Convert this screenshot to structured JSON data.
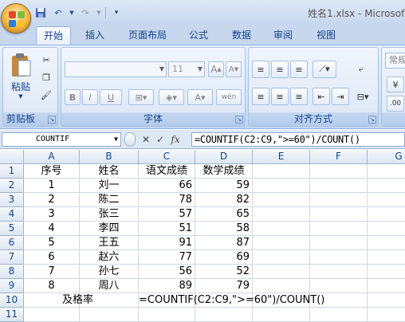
{
  "window": {
    "title": "姓名1.xlsx - Microsof"
  },
  "tabs": [
    "开始",
    "插入",
    "页面布局",
    "公式",
    "数据",
    "审阅",
    "视图"
  ],
  "ribbon": {
    "clipboard": {
      "label": "剪贴板",
      "paste": "粘贴"
    },
    "font": {
      "label": "字体",
      "font_size": "11",
      "bold": "B",
      "italic": "I",
      "underline": "U",
      "wen": "wén"
    },
    "alignment": {
      "label": "对齐方式"
    },
    "number": {
      "format": "常规"
    }
  },
  "formula_bar": {
    "name_box": "COUNTIF",
    "formula": "=COUNTIF(C2:C9,\">=60\")/COUNT()"
  },
  "columns": [
    "A",
    "B",
    "C",
    "D",
    "E",
    "F",
    "G"
  ],
  "rows": [
    {
      "n": "1",
      "a": "序号",
      "b": "姓名",
      "c": "语文成绩",
      "d": "数学成绩"
    },
    {
      "n": "2",
      "a": "1",
      "b": "刘一",
      "c": "66",
      "d": "59"
    },
    {
      "n": "3",
      "a": "2",
      "b": "陈二",
      "c": "78",
      "d": "82"
    },
    {
      "n": "4",
      "a": "3",
      "b": "张三",
      "c": "57",
      "d": "65"
    },
    {
      "n": "5",
      "a": "4",
      "b": "李四",
      "c": "51",
      "d": "58"
    },
    {
      "n": "6",
      "a": "5",
      "b": "王五",
      "c": "91",
      "d": "87"
    },
    {
      "n": "7",
      "a": "6",
      "b": "赵六",
      "c": "77",
      "d": "69"
    },
    {
      "n": "8",
      "a": "7",
      "b": "孙七",
      "c": "56",
      "d": "52"
    },
    {
      "n": "9",
      "a": "8",
      "b": "周八",
      "c": "89",
      "d": "79"
    },
    {
      "n": "10",
      "a": "及格率",
      "b": "",
      "c": "=COUNTIF(C2:C9,\">=60\")/COUNT()",
      "d": ""
    },
    {
      "n": "11",
      "a": "",
      "b": "",
      "c": "",
      "d": ""
    }
  ]
}
